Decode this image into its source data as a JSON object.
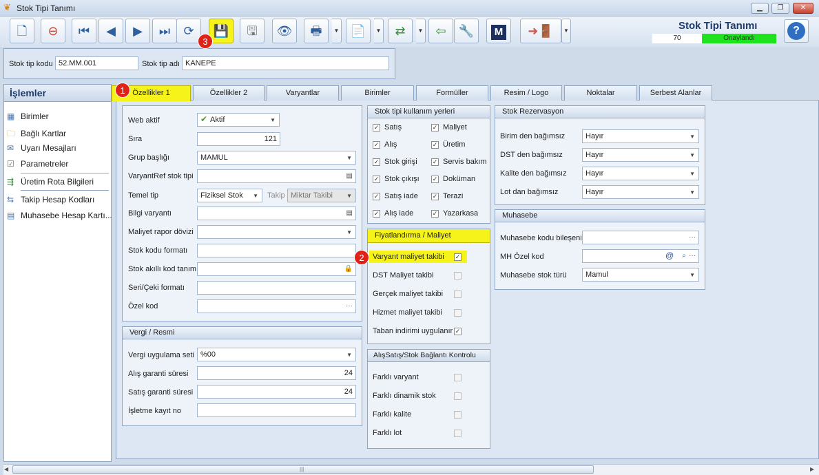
{
  "window": {
    "title": "Stok Tipi Tanımı"
  },
  "header": {
    "title": "Stok Tipi Tanımı",
    "count": "70",
    "status": "Onaylandı"
  },
  "badges": [
    "1",
    "2",
    "3"
  ],
  "fields": {
    "kod_label": "Stok tip kodu",
    "kod_value": "52.MM.001",
    "adi_label": "Stok tip adı",
    "adi_value": "KANEPE"
  },
  "sidebar": {
    "title": "İşlemler",
    "items": [
      "Birimler",
      "Bağlı Kartlar",
      "Uyarı Mesajları",
      "Parametreler",
      "Üretim Rota Bilgileri",
      "Takip Hesap Kodları",
      "Muhasebe Hesap Kartı..."
    ]
  },
  "tabs": [
    "Özellikler 1",
    "Özellikler 2",
    "Varyantlar",
    "Birimler",
    "Formüller",
    "Resim / Logo",
    "Noktalar",
    "Serbest Alanlar"
  ],
  "props": {
    "web_aktif_label": "Web aktif",
    "web_aktif": "Aktif",
    "sira_label": "Sıra",
    "sira": "121",
    "grup_label": "Grup başlığı",
    "grup": "MAMUL",
    "varyantref_label": "VaryantRef stok tipi",
    "temel_label": "Temel tip",
    "temel": "Fiziksel Stok",
    "takip_label": "Takip",
    "takip": "Miktar Takibi",
    "bilgi_label": "Bilgi varyantı",
    "maliyet_doviz_label": "Maliyet rapor dövizi",
    "kod_format_label": "Stok kodu formatı",
    "akilli_label": "Stok akıllı kod tanımı",
    "seri_label": "Seri/Çeki formatı",
    "ozel_label": "Özel kod"
  },
  "vergi": {
    "title": "Vergi / Resmi",
    "uyg_label": "Vergi uygulama seti",
    "uyg": "%00",
    "alis_label": "Alış garanti süresi",
    "alis": "24",
    "satis_label": "Satış garanti süresi",
    "satis": "24",
    "isletme_label": "İşletme kayıt no"
  },
  "kullanim": {
    "title": "Stok tipi kullanım yerleri",
    "items": [
      "Satış",
      "Maliyet",
      "Alış",
      "Üretim",
      "Stok girişi",
      "Servis bakım",
      "Stok çıkışı",
      "Doküman",
      "Satış iade",
      "Terazi",
      "Alış iade",
      "Yazarkasa"
    ],
    "checked": [
      true,
      true,
      true,
      true,
      true,
      true,
      true,
      true,
      true,
      true,
      true,
      true
    ]
  },
  "fiyat": {
    "title": "Fiyatlandırma / Maliyet",
    "items": [
      "Varyant maliyet takibi",
      "DST Maliyet takibi",
      "Gerçek maliyet takibi",
      "Hizmet maliyet takibi",
      "Taban indirimi uygulanır"
    ],
    "checked": [
      true,
      false,
      false,
      false,
      true
    ]
  },
  "alissatis": {
    "title": "AlışSatış/Stok Bağlantı Kontrolu",
    "items": [
      "Farklı varyant",
      "Farklı dinamik stok",
      "Farklı kalite",
      "Farklı lot"
    ],
    "checked": [
      false,
      false,
      false,
      false
    ]
  },
  "rezervasyon": {
    "title": "Stok Rezervasyon",
    "items": [
      {
        "label": "Birim den bağımsız",
        "value": "Hayır"
      },
      {
        "label": "DST den bağımsız",
        "value": "Hayır"
      },
      {
        "label": "Kalite den bağımsız",
        "value": "Hayır"
      },
      {
        "label": "Lot dan bağımsız",
        "value": "Hayır"
      }
    ]
  },
  "muhasebe": {
    "title": "Muhasebe",
    "bilesen_label": "Muhasebe kodu bileşeni",
    "mh_label": "MH Özel kod",
    "tur_label": "Muhasebe stok türü",
    "tur": "Mamul"
  },
  "colors": {
    "highlight": "#f5f31a",
    "status_green": "#1ee31e",
    "badge": "#e02118",
    "header_blue": "#1c3b6b"
  },
  "icons": [
    "new-document-icon",
    "delete-document-icon",
    "first-record-icon",
    "previous-record-icon",
    "next-record-icon",
    "last-record-icon",
    "refresh-icon",
    "save-icon",
    "save-close-icon",
    "preview-icon",
    "print-icon",
    "pdf-export-icon",
    "export-icon",
    "import-icon",
    "tools-icon",
    "m-logo-icon",
    "exit-icon",
    "help-icon"
  ]
}
